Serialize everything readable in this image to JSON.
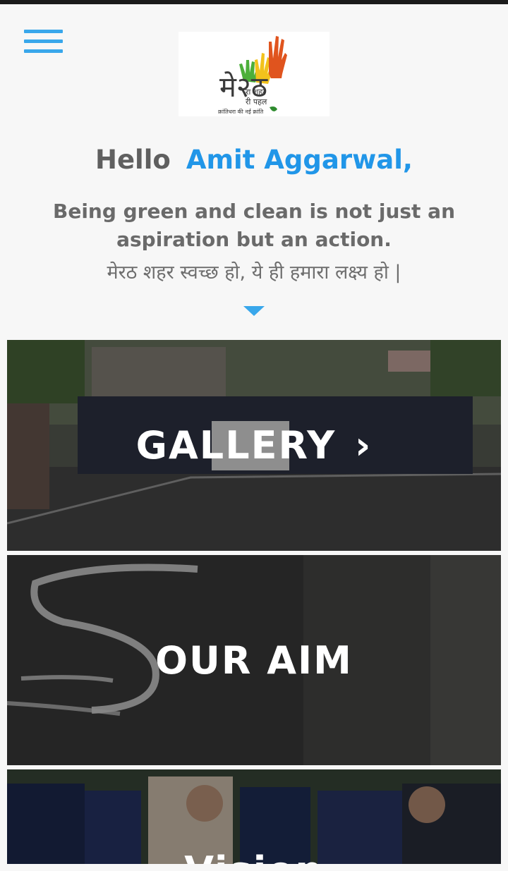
{
  "app": {
    "logo_text_line1": "मे२ठ",
    "logo_text_line2": "रा शहर",
    "logo_text_line3": "री पहल",
    "logo_tagline": "क्रांतिधरा की नई क्रांति"
  },
  "greeting": {
    "hello": "Hello",
    "name": "Amit Aggarwal,"
  },
  "tagline": {
    "english": "Being green and clean is not just an aspiration but an action.",
    "hindi": "मेरठ शहर स्वच्छ हो, ये ही हमारा लक्ष्य हो |"
  },
  "cards": [
    {
      "label": "GALLERY",
      "chevron": "›"
    },
    {
      "label": "OUR AIM"
    },
    {
      "label": "Vision"
    }
  ],
  "colors": {
    "accent": "#39a7eb",
    "name": "#2196e8",
    "text": "#5f5f5f",
    "hand_green": "#4caf3a",
    "hand_yellow": "#f2c21c",
    "hand_red": "#e0541e"
  },
  "icons": {
    "menu": "hamburger-icon",
    "scroll": "caret-down-icon",
    "chevron": "chevron-right-icon"
  }
}
